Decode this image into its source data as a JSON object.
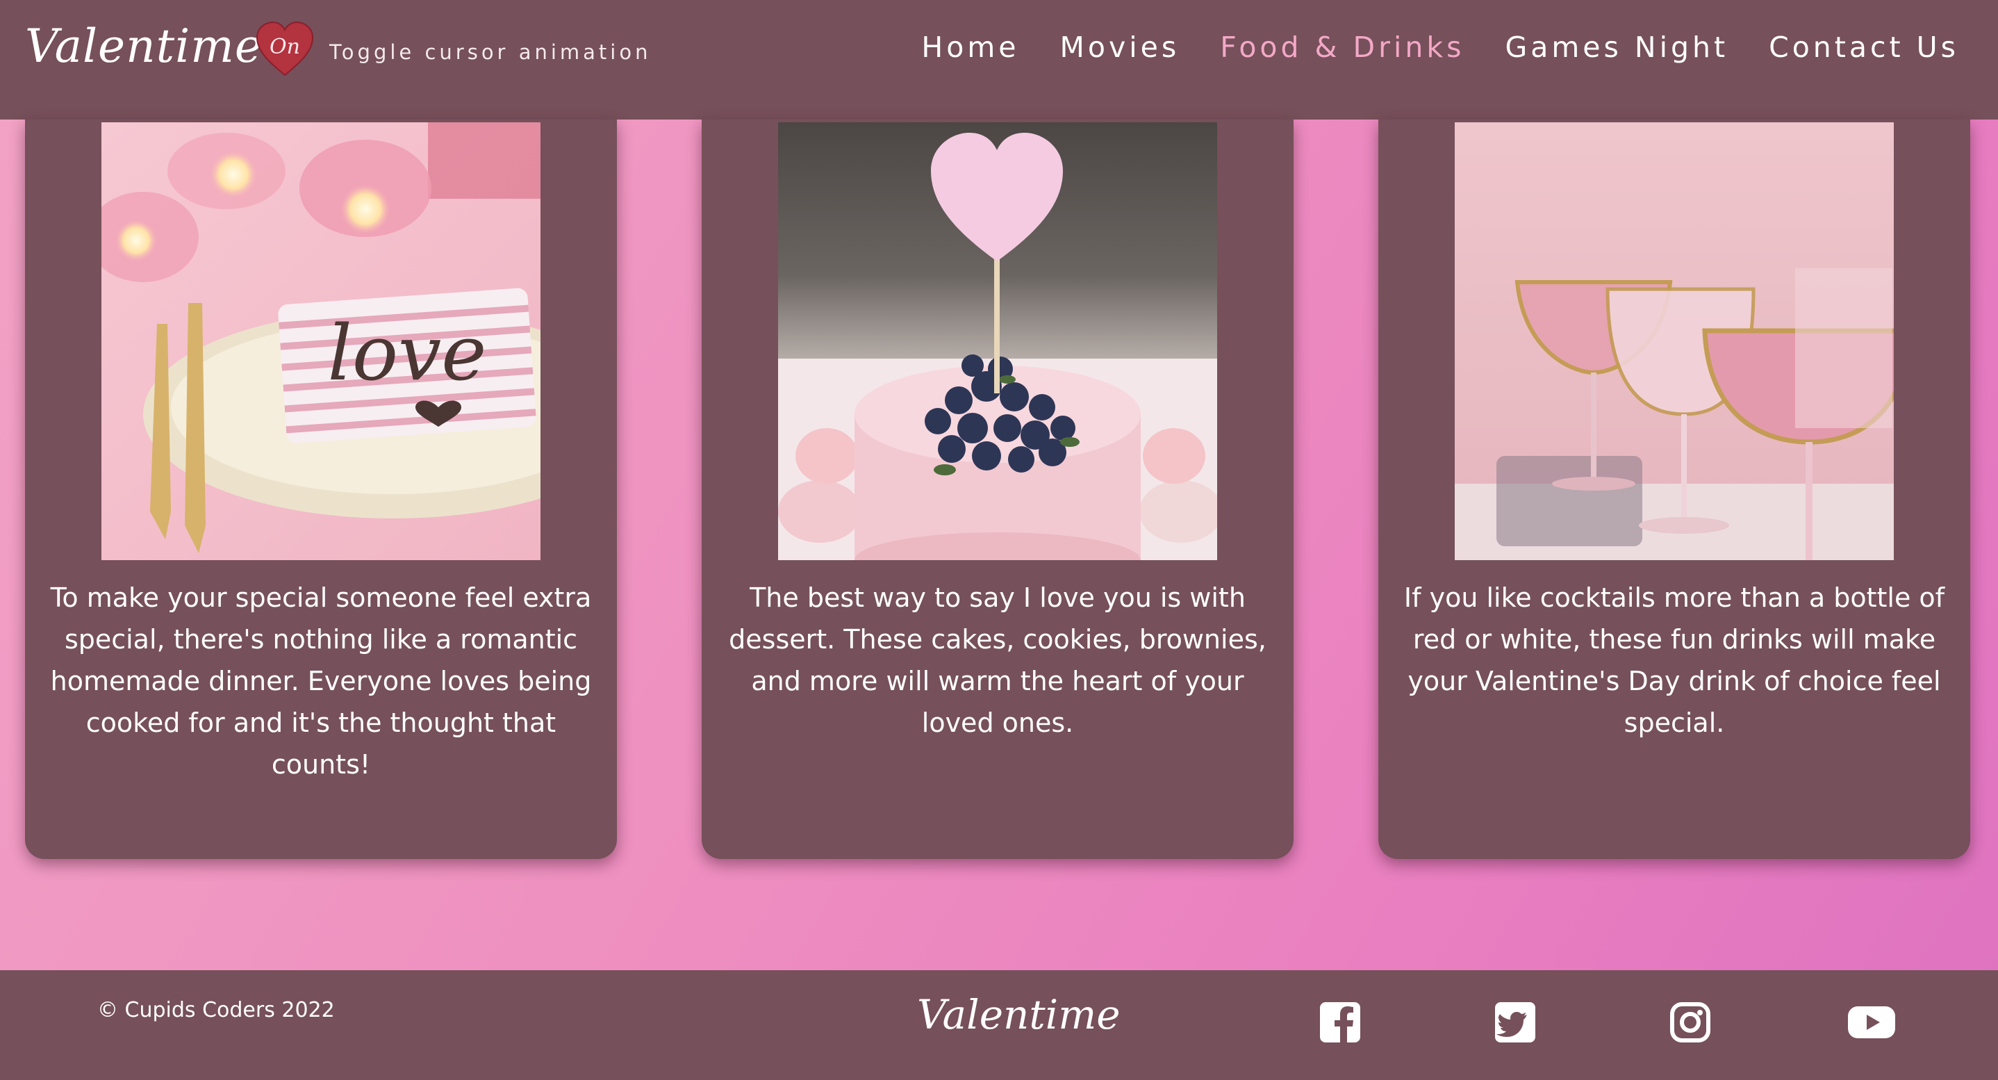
{
  "header": {
    "logo": "Valentime",
    "toggle": {
      "state_label": "On",
      "text": "Toggle cursor animation"
    },
    "nav": [
      {
        "label": "Home",
        "active": false
      },
      {
        "label": "Movies",
        "active": false
      },
      {
        "label": "Food & Drinks",
        "active": true
      },
      {
        "label": "Games Night",
        "active": false
      },
      {
        "label": "Contact Us",
        "active": false
      }
    ]
  },
  "cards": [
    {
      "text": "To make your special someone feel extra special, there's nothing like a romantic homemade dinner. Everyone loves being cooked for and it's the thought that counts!"
    },
    {
      "text": "The best way to say I love you is with dessert. These cakes, cookies, brownies, and more will warm the heart of your loved ones."
    },
    {
      "text": "If you like cocktails more than a bottle of red or white, these fun drinks will make your Valentine's Day drink of choice feel special."
    }
  ],
  "photo1": {
    "plate_text": "love"
  },
  "footer": {
    "copyright": "© Cupids Coders 2022",
    "logo": "Valentime",
    "social": [
      "facebook-icon",
      "twitter-icon",
      "instagram-icon",
      "youtube-icon"
    ]
  },
  "colors": {
    "panel": "#76505a",
    "active_nav": "#f3a8c7",
    "background_start": "#f2a3c5",
    "background_end": "#de72c0",
    "toggle_heart": "#b3333f"
  }
}
